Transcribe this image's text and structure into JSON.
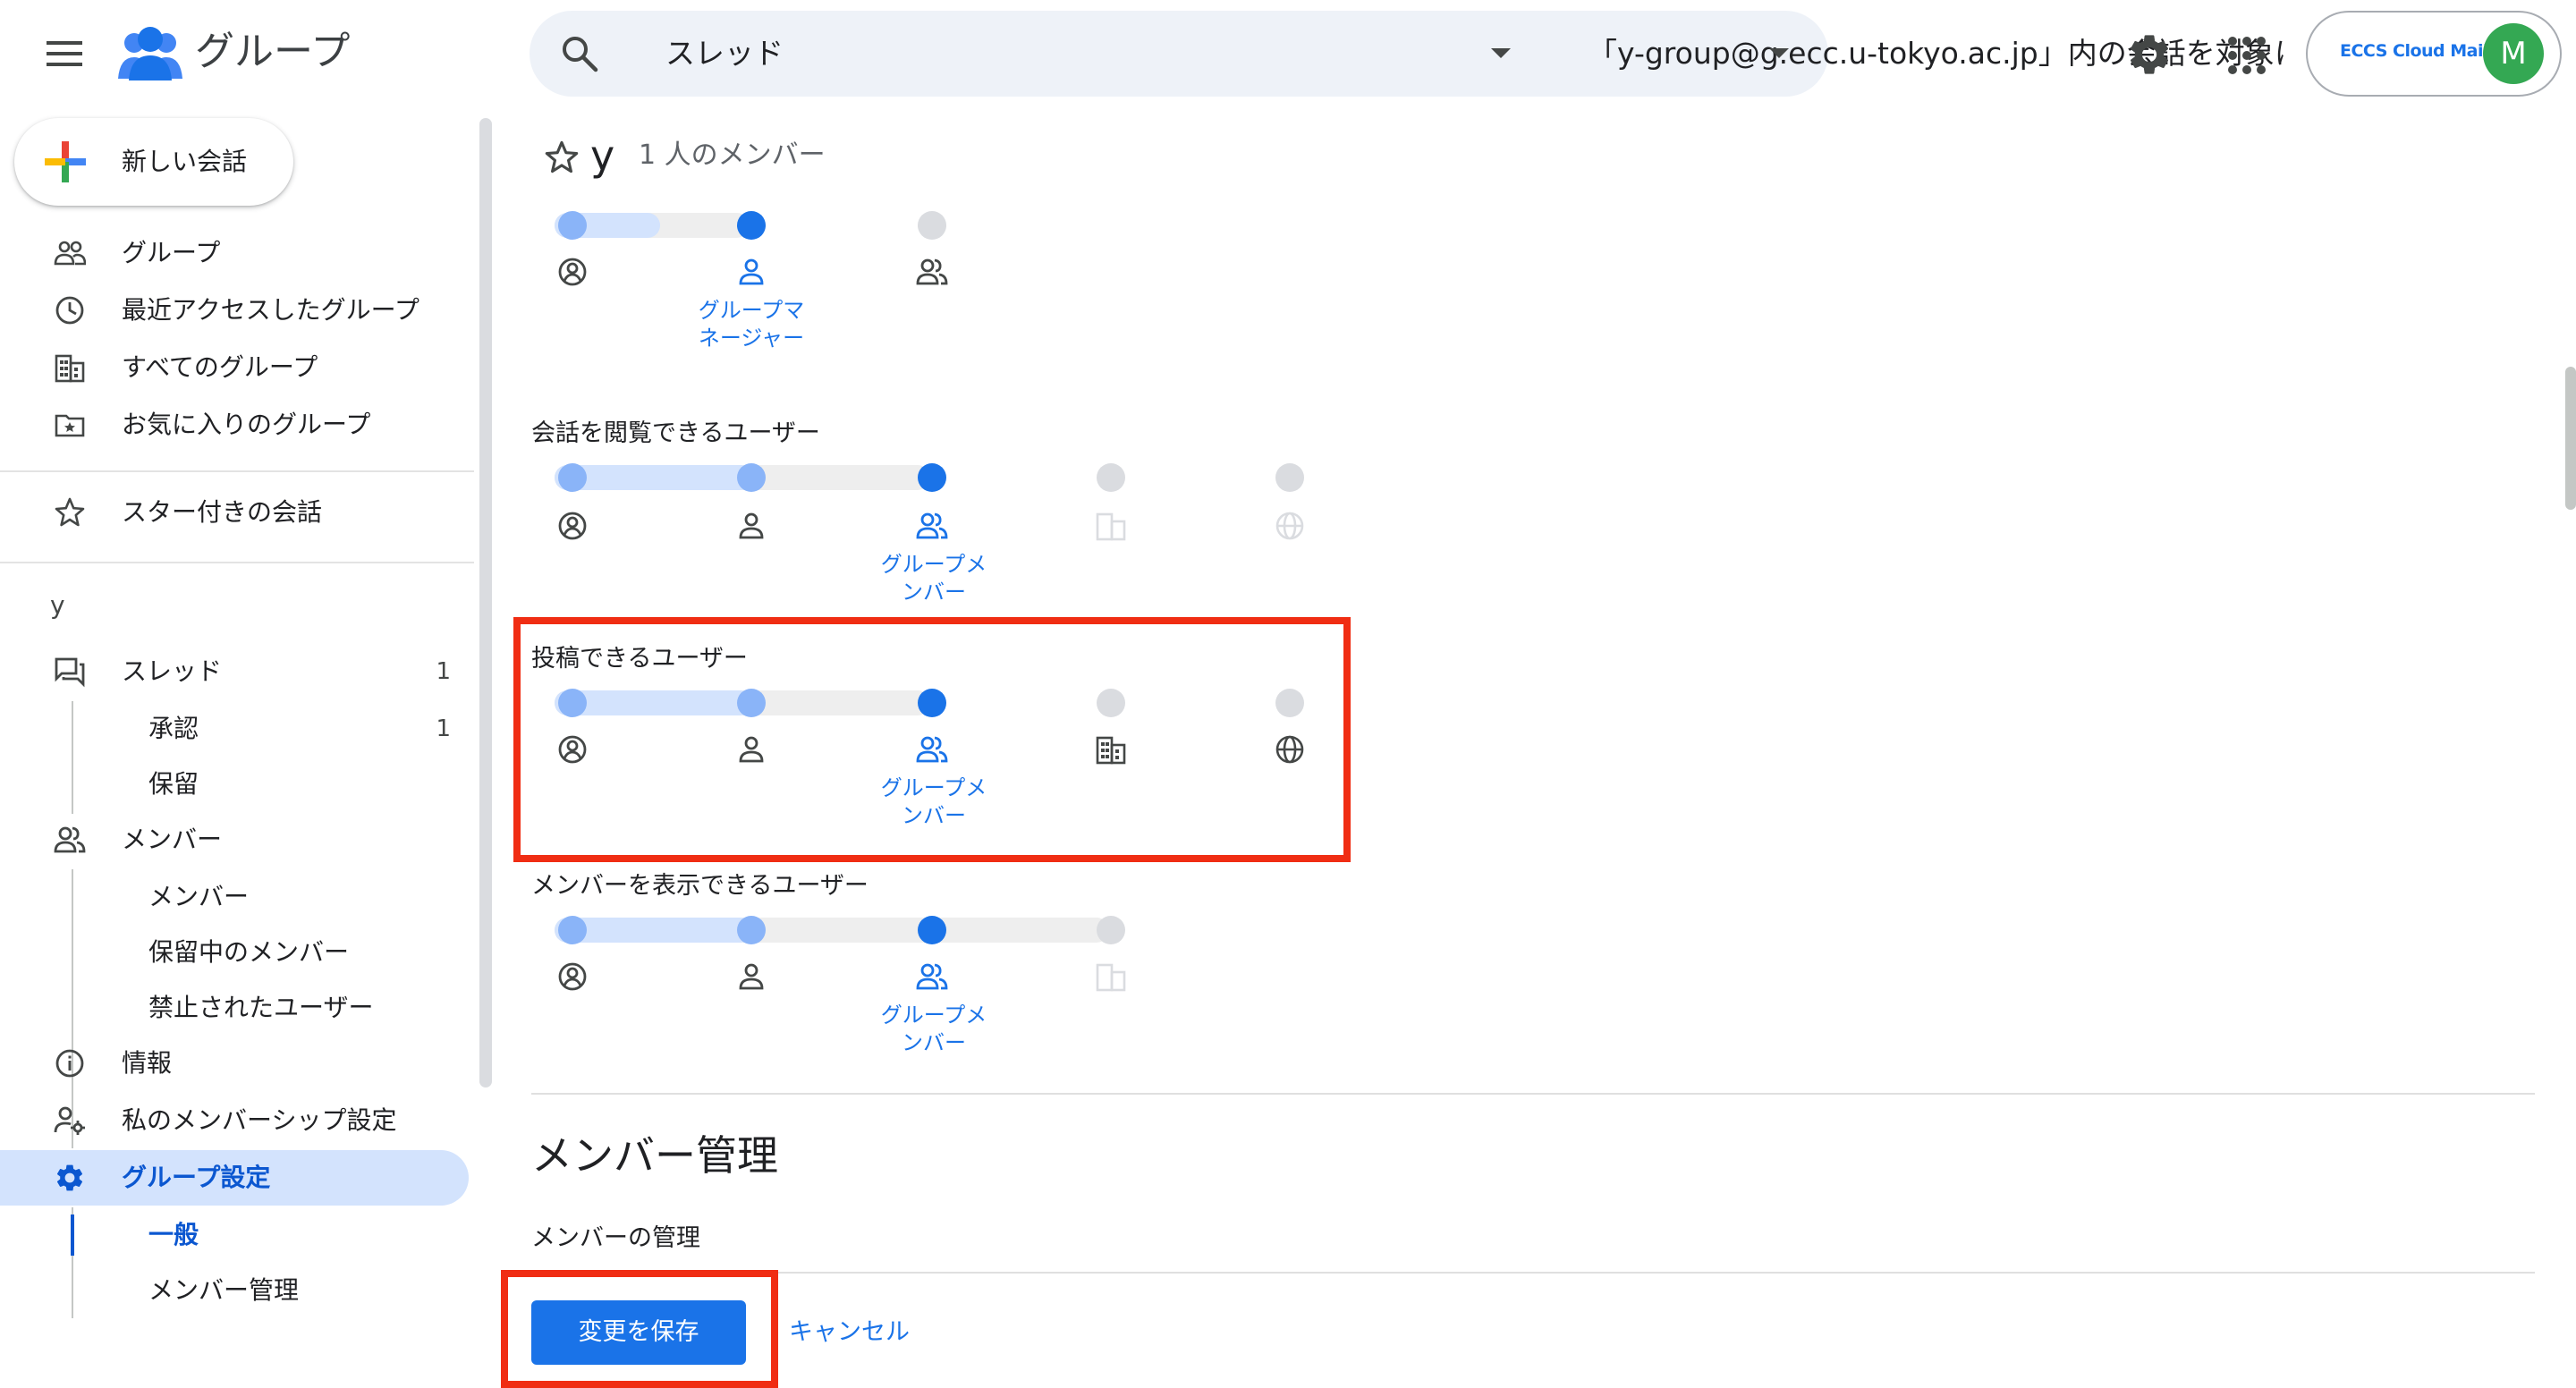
{
  "header": {
    "app_title": "グループ",
    "search_scope": "スレッド",
    "search_placeholder": "「y-group@g.ecc.u-tokyo.ac.jp」内の会話を対象に...",
    "account_logo": "ECCS Cloud Mail",
    "account_initial": "M"
  },
  "sidebar": {
    "new_conversation": "新しい会話",
    "main_items": [
      {
        "label": "グループ",
        "icon": "people-icon"
      },
      {
        "label": "最近アクセスしたグループ",
        "icon": "clock-icon"
      },
      {
        "label": "すべてのグループ",
        "icon": "building-icon"
      },
      {
        "label": "お気に入りのグループ",
        "icon": "folder-star-icon"
      }
    ],
    "starred": "スター付きの会話",
    "group_label": "y",
    "threads": {
      "label": "スレッド",
      "count": "1"
    },
    "approval": {
      "label": "承認",
      "count": "1"
    },
    "pending": "保留",
    "members": "メンバー",
    "members_sub": [
      "メンバー",
      "保留中のメンバー",
      "禁止されたユーザー"
    ],
    "info": "情報",
    "my_membership": "私のメンバーシップ設定",
    "group_settings": "グループ設定",
    "settings_sub": [
      "一般",
      "メンバー管理"
    ]
  },
  "content": {
    "group_name": "y",
    "member_count": "1 人のメンバー",
    "settings": [
      {
        "label": "",
        "levels": 3,
        "selected": 1,
        "caption": "グループマネージャー"
      },
      {
        "label": "会話を閲覧できるユーザー",
        "levels": 5,
        "selected": 2,
        "caption": "グループメンバー"
      },
      {
        "label": "投稿できるユーザー",
        "levels": 5,
        "selected": 2,
        "caption": "グループメンバー"
      },
      {
        "label": "メンバーを表示できるユーザー",
        "levels": 4,
        "selected": 2,
        "caption": "グループメンバー"
      }
    ],
    "section_title": "メンバー管理",
    "section_sub": "メンバーの管理",
    "save": "変更を保存",
    "cancel": "キャンセル"
  },
  "colors": {
    "accent": "#1a73e8",
    "highlight": "#f02d13",
    "track_fill": "#d3e3fd",
    "active_nav": "#d3e3fd"
  }
}
